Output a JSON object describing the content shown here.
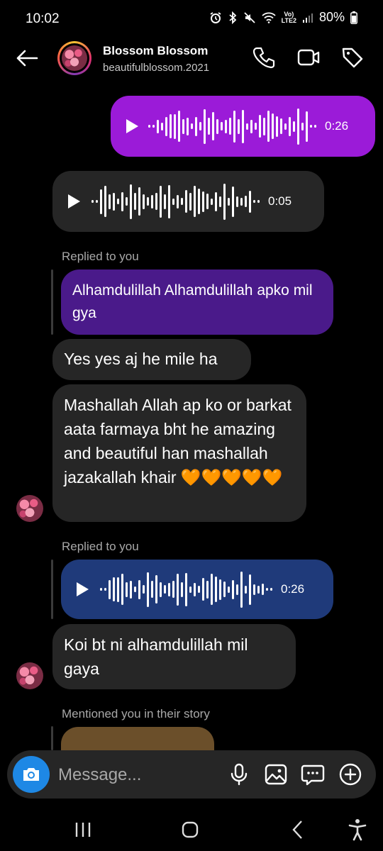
{
  "status_bar": {
    "time": "10:02",
    "network": "Vo)\nLTE2",
    "battery": "80%"
  },
  "header": {
    "name": "Blossom Blossom",
    "username": "beautifulblossom.2021"
  },
  "messages": {
    "voice1_duration": "0:26",
    "voice2_duration": "0:05",
    "reply1_label": "Replied to you",
    "reply1_quote": "Alhamdulillah Alhamdulillah apko mil gya",
    "text1": "Yes yes aj he mile ha",
    "text2": "Mashallah Allah ap ko or barkat aata farmaya bht he amazing and beautiful han mashallah jazakallah khair 🧡🧡🧡🧡🧡",
    "reply2_label": "Replied to you",
    "voice3_duration": "0:26",
    "text3": "Koi bt ni alhamdulillah mil gaya",
    "story_label": "Mentioned you in their story"
  },
  "composer": {
    "placeholder": "Message..."
  },
  "colors": {
    "sent_bubble": "#9b1bd8",
    "received_bubble": "#262626",
    "reply_quote": "#4a1a8a",
    "reply_voice": "#1f3a7a",
    "camera_button": "#1e88e5"
  },
  "icons": [
    "back-arrow-icon",
    "phone-icon",
    "video-icon",
    "tag-icon",
    "camera-icon",
    "mic-icon",
    "gallery-icon",
    "sticker-icon",
    "plus-icon",
    "recents-icon",
    "home-icon",
    "back-icon",
    "accessibility-icon"
  ]
}
